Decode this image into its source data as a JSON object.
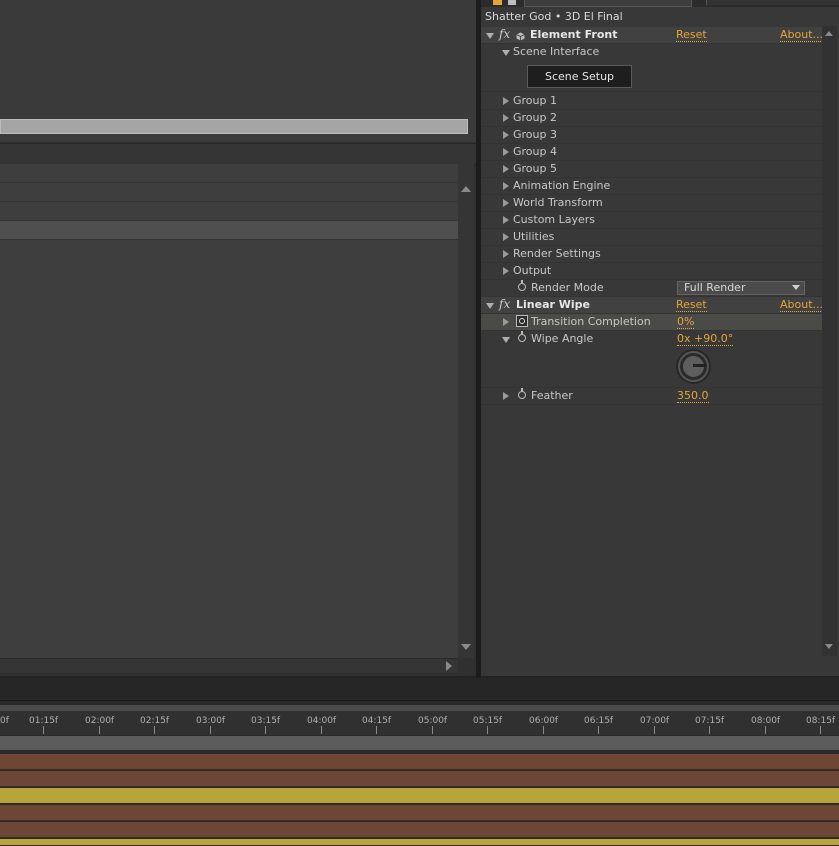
{
  "effects_panel": {
    "subtitle": "Shatter God • 3D El Final",
    "effects": [
      {
        "name": "Element Front",
        "reset": "Reset",
        "about": "About...",
        "scene_interface": "Scene Interface",
        "scene_setup_button": "Scene Setup",
        "groups": [
          "Group 1",
          "Group 2",
          "Group 3",
          "Group 4",
          "Group 5",
          "Animation Engine",
          "World Transform",
          "Custom Layers",
          "Utilities",
          "Render Settings",
          "Output"
        ],
        "render_mode": {
          "label": "Render Mode",
          "value": "Full Render"
        }
      },
      {
        "name": "Linear Wipe",
        "reset": "Reset",
        "about": "About...",
        "transition_completion": {
          "label": "Transition Completion",
          "value": "0%"
        },
        "wipe_angle": {
          "label": "Wipe Angle",
          "value": "0x +90.0°"
        },
        "feather": {
          "label": "Feather",
          "value": "350.0"
        }
      }
    ]
  },
  "timeline": {
    "ruler_labels": [
      "0f",
      "01:15f",
      "02:00f",
      "02:15f",
      "03:00f",
      "03:15f",
      "04:00f",
      "04:15f",
      "05:00f",
      "05:15f",
      "06:00f",
      "06:15f",
      "07:00f",
      "07:15f",
      "08:00f",
      "08:15f"
    ],
    "track_colors": [
      "#6e4636",
      "#6e4636",
      "#b5a53c",
      "#6e4636",
      "#6e4636",
      "#b5a53c"
    ]
  },
  "colors": {
    "accent_link": "#e3a53a",
    "panel_bg": "#383838"
  }
}
